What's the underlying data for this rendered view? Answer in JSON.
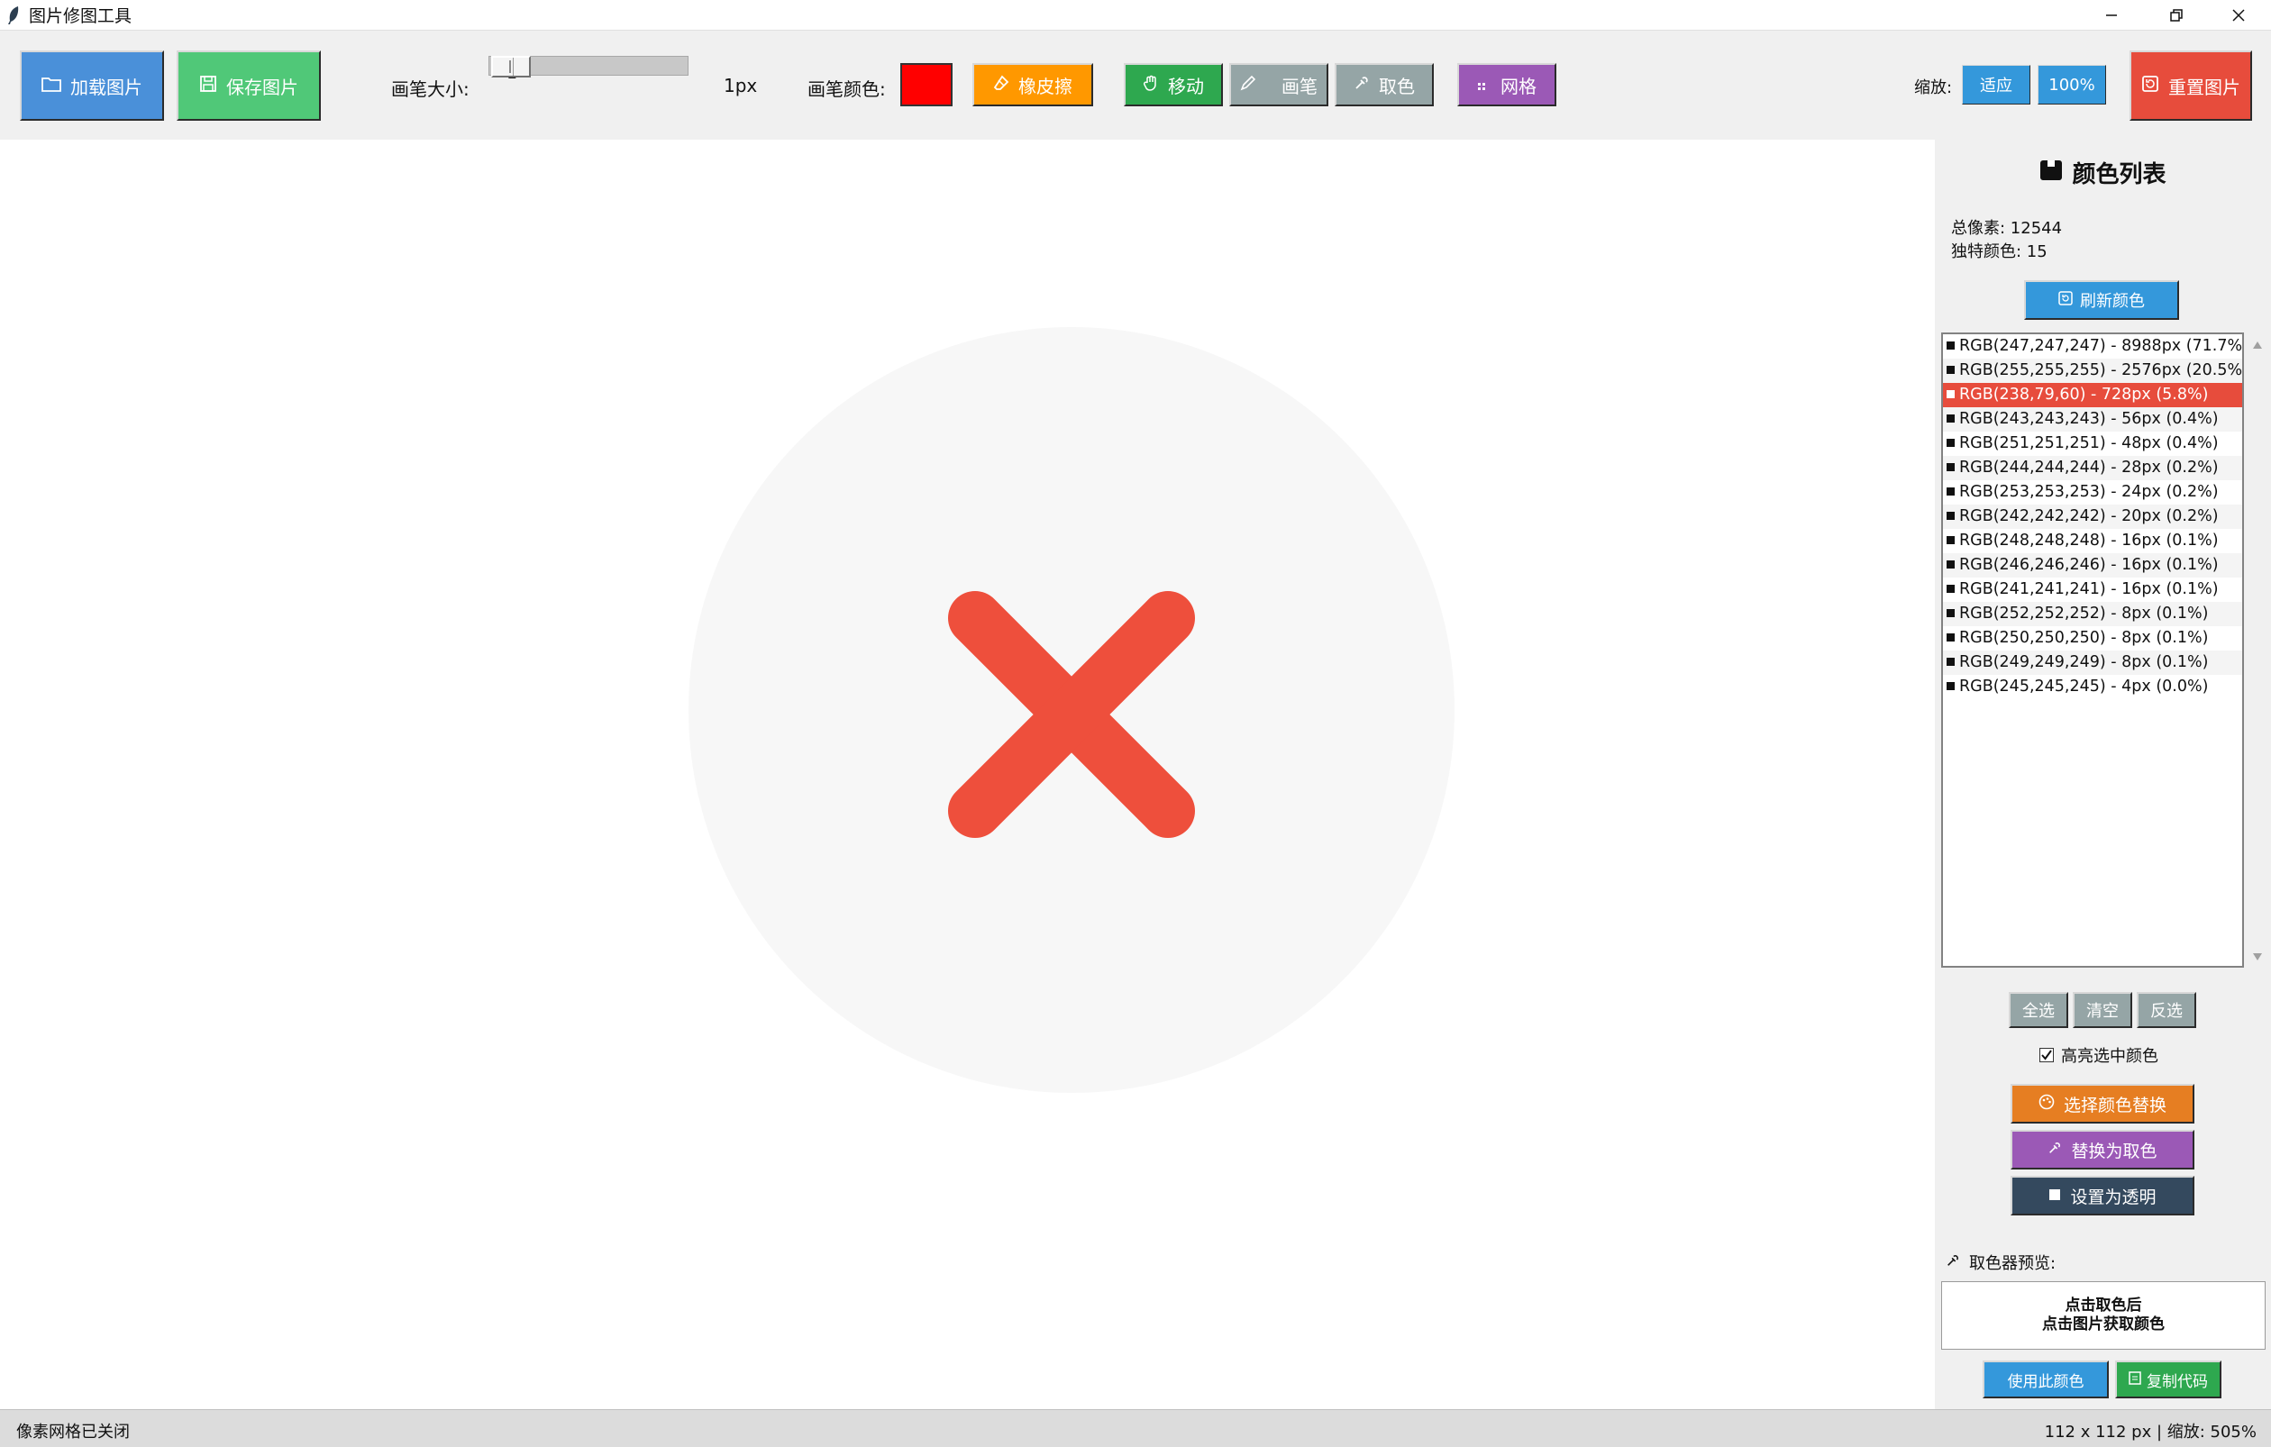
{
  "window": {
    "title": "图片修图工具"
  },
  "toolbar": {
    "load_label": "加载图片",
    "save_label": "保存图片",
    "brush_size_label": "画笔大小:",
    "brush_size_value": 1,
    "brush_size_display": "1",
    "brush_size_unit": "1px",
    "brush_color_label": "画笔颜色:",
    "brush_color": "#ff0000",
    "eraser_label": "橡皮擦",
    "move_label": "移动",
    "pen_label": "画笔",
    "picker_label": "取色",
    "grid_label": "网格",
    "zoom_label": "缩放:",
    "fit_label": "适应",
    "zoom100_label": "100%",
    "reset_label": "重置图片"
  },
  "panel": {
    "title": "颜色列表",
    "total_pixels": "总像素: 12544",
    "unique_colors": "独特颜色: 15",
    "refresh_label": "刷新颜色",
    "colors": [
      "RGB(247,247,247) - 8988px (71.7%)",
      "RGB(255,255,255) - 2576px (20.5%)",
      "RGB(238,79,60) - 728px (5.8%)",
      "RGB(243,243,243) - 56px (0.4%)",
      "RGB(251,251,251) - 48px (0.4%)",
      "RGB(244,244,244) - 28px (0.2%)",
      "RGB(253,253,253) - 24px (0.2%)",
      "RGB(242,242,242) - 20px (0.2%)",
      "RGB(248,248,248) - 16px (0.1%)",
      "RGB(246,246,246) - 16px (0.1%)",
      "RGB(241,241,241) - 16px (0.1%)",
      "RGB(252,252,252) - 8px (0.1%)",
      "RGB(250,250,250) - 8px (0.1%)",
      "RGB(249,249,249) - 8px (0.1%)",
      "RGB(245,245,245) - 4px (0.0%)"
    ],
    "selected_index": 2,
    "select_all_label": "全选",
    "clear_label": "清空",
    "invert_label": "反选",
    "highlight_label": "高亮选中颜色",
    "highlight_checked": true,
    "replace_selected_label": "选择颜色替换",
    "replace_with_picked_label": "替换为取色",
    "set_transparent_label": "设置为透明",
    "picker_preview_label": "取色器预览:",
    "picker_hint_line1": "点击取色后",
    "picker_hint_line2": "点击图片获取颜色",
    "use_color_label": "使用此颜色",
    "copy_code_label": "复制代码"
  },
  "statusbar": {
    "left": "像素网格已关闭",
    "right": "112 x 112 px | 缩放: 505%"
  },
  "colors": {
    "blue": "#4a90d9",
    "green": "#50c878",
    "orange": "#ff9800",
    "dark_green": "#2ea84f",
    "gray": "#95a5a6",
    "purple": "#9b59b6",
    "sky": "#3498db",
    "red": "#e74c3c",
    "dark_orange": "#e67e22",
    "navy": "#34495e",
    "image_bg": "#f7f7f7",
    "image_x": "#ee4f3c"
  }
}
